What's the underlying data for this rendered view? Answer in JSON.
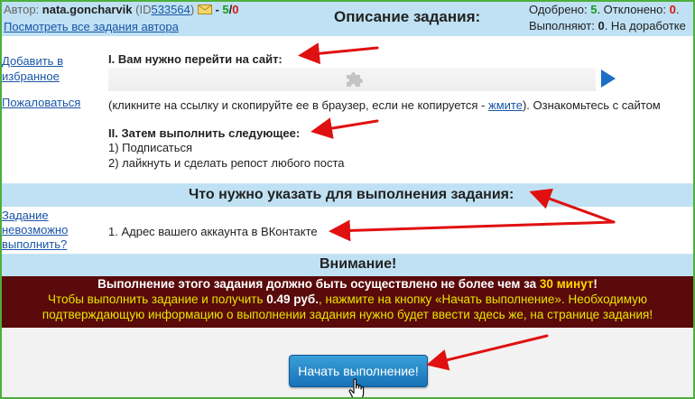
{
  "header": {
    "author_label": "Автор:",
    "author_name": "nata.goncharvik",
    "id_open": "(ID",
    "id_value": "533564",
    "id_close": ")",
    "score_dash": "-",
    "score_green": "5",
    "score_sep": "/",
    "score_red": "0",
    "view_all_link": "Посмотреть все задания автора",
    "title": "Описание задания:",
    "approved_label": "Одобрено:",
    "approved_value": "5",
    "rejected_label": ". Отклонено:",
    "rejected_value": "0",
    "rejected_tail": ".",
    "in_progress_label": "Выполняют:",
    "in_progress_value": "0",
    "on_revision_label": ". На доработке"
  },
  "sidebar": {
    "favorite_line1": "Добавить в",
    "favorite_line2": "избранное",
    "complain": "Пожаловаться",
    "cannot_line1": "Задание",
    "cannot_line2": "невозможно",
    "cannot_line3": "выполнить?"
  },
  "task": {
    "step1_title": "I. Вам нужно перейти на сайт:",
    "hint_text": "(кликните на ссылку и скопируйте ее в браузер, если не копируется -",
    "hint_link": "жмите",
    "hint_tail": "). Ознакомьтесь с сайтом",
    "step2_title": "II. Затем выполнить следующее:",
    "step2_item1": "1) Подписаться",
    "step2_item2": "2) лайкнуть и сделать репост любого поста"
  },
  "report": {
    "title": "Что нужно указать для выполнения задания:",
    "item1": "1. Адрес вашего аккаунта в ВКонтакте"
  },
  "attention": {
    "title": "Внимание!",
    "line1_prefix": "Выполнение этого задания должно быть осуществлено не более чем за",
    "line1_time": "30 минут",
    "line1_suffix": "!",
    "line2_prefix": "Чтобы выполнить задание и получить",
    "line2_amount": "0.49 руб.",
    "line2_suffix": ", нажмите на кнопку «Начать выполнение». Необходимую",
    "line3": "подтверждающую информацию о выполнении задания нужно будет ввести здесь же, на странице задания!"
  },
  "actions": {
    "start_button": "Начать выполнение!"
  },
  "icons": {
    "envelope": "envelope-icon",
    "puzzle": "plugin-puzzle-icon",
    "play": "play-icon",
    "cursor": "hand-pointer-icon"
  },
  "colors": {
    "header_band": "#bfe1f3",
    "warning_band": "#5a0a0a",
    "highlight_yellow": "#ffd700",
    "accent_green": "#1a9a1a",
    "accent_red": "#d11111",
    "button_blue": "#1e7fc4",
    "annotation_arrow": "#e01010",
    "frame_border": "#4caf3c"
  }
}
